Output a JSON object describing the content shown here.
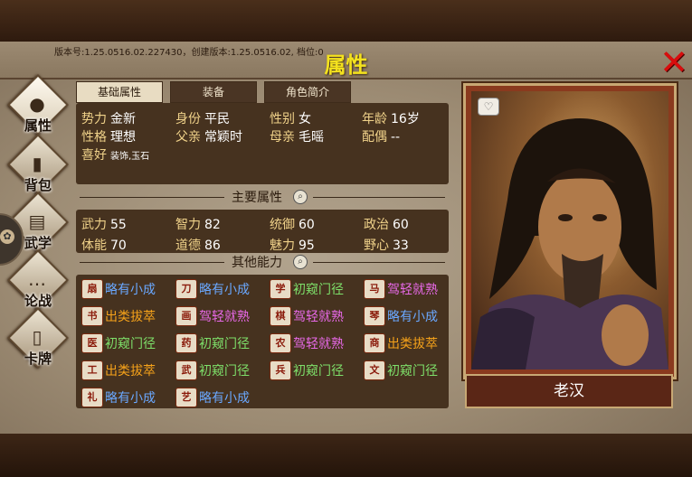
{
  "header": {
    "version_text": "版本号:1.25.0516.02.227430，创建版本:1.25.0516.02, 档位:0",
    "title": "属性",
    "close_glyph": "✕"
  },
  "sidebar": {
    "items": [
      {
        "label": "属性",
        "icon": "character-bust-icon",
        "glyph": "●",
        "active": true
      },
      {
        "label": "背包",
        "icon": "bag-icon",
        "glyph": "▮"
      },
      {
        "label": "武学",
        "icon": "martial-book-icon",
        "glyph": "▤"
      },
      {
        "label": "论战",
        "icon": "debate-speech-icon",
        "glyph": "…"
      },
      {
        "label": "卡牌",
        "icon": "cards-icon",
        "glyph": "▯"
      }
    ]
  },
  "tabs": [
    {
      "label": "基础属性",
      "active": true
    },
    {
      "label": "装备",
      "active": false
    },
    {
      "label": "角色简介",
      "active": false
    }
  ],
  "basic_info": {
    "faction": {
      "label": "势力",
      "value": "金新"
    },
    "status": {
      "label": "身份",
      "value": "平民"
    },
    "gender": {
      "label": "性别",
      "value": "女"
    },
    "age": {
      "label": "年龄",
      "value": "16岁"
    },
    "personality": {
      "label": "性格",
      "value": "理想"
    },
    "father": {
      "label": "父亲",
      "value": "常颖时"
    },
    "mother": {
      "label": "母亲",
      "value": "毛暚"
    },
    "spouse": {
      "label": "配偶",
      "value": "--"
    },
    "hobby": {
      "label": "喜好",
      "value": "装饰,玉石"
    }
  },
  "main_attributes": {
    "title": "主要属性",
    "items": [
      {
        "label": "武力",
        "value": "55"
      },
      {
        "label": "智力",
        "value": "82"
      },
      {
        "label": "统御",
        "value": "60"
      },
      {
        "label": "政治",
        "value": "60"
      },
      {
        "label": "体能",
        "value": "70"
      },
      {
        "label": "道德",
        "value": "86"
      },
      {
        "label": "魅力",
        "value": "95"
      },
      {
        "label": "野心",
        "value": "33"
      }
    ]
  },
  "other_abilities": {
    "title": "其他能力",
    "colors": {
      "略有小成": "#6aa8ff",
      "出类拔萃": "#f5a21a",
      "驾轻就熟": "#e869e8",
      "初窥门径": "#7ee06a"
    },
    "items": [
      {
        "icon": "扇",
        "level": "略有小成"
      },
      {
        "icon": "刀",
        "level": "略有小成"
      },
      {
        "icon": "学",
        "level": "初窥门径"
      },
      {
        "icon": "马",
        "level": "驾轻就熟"
      },
      {
        "icon": "书",
        "level": "出类拔萃"
      },
      {
        "icon": "画",
        "level": "驾轻就熟"
      },
      {
        "icon": "棋",
        "level": "驾轻就熟"
      },
      {
        "icon": "琴",
        "level": "略有小成"
      },
      {
        "icon": "医",
        "level": "初窥门径"
      },
      {
        "icon": "药",
        "level": "初窥门径"
      },
      {
        "icon": "农",
        "level": "驾轻就熟"
      },
      {
        "icon": "商",
        "level": "出类拔萃"
      },
      {
        "icon": "工",
        "level": "出类拔萃"
      },
      {
        "icon": "武",
        "level": "初窥门径"
      },
      {
        "icon": "兵",
        "level": "初窥门径"
      },
      {
        "icon": "文",
        "level": "初窥门径"
      },
      {
        "icon": "礼",
        "level": "略有小成"
      },
      {
        "icon": "艺",
        "level": "略有小成"
      }
    ]
  },
  "portrait": {
    "name": "老汉",
    "favor_icon": "heart-icon",
    "favor_glyph": "♡"
  }
}
